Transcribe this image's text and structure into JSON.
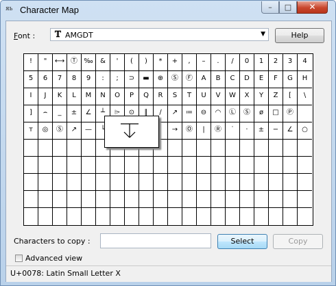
{
  "window": {
    "title": "Character Map"
  },
  "font": {
    "label_prefix": "F",
    "label_rest": "ont :",
    "value": "AMGDT",
    "font_type_icon": "truetype-icon"
  },
  "buttons": {
    "help": "Help",
    "select": "Select",
    "copy": "Copy"
  },
  "copy_field": {
    "label": "Characters to copy :",
    "value": ""
  },
  "advanced": {
    "label": "Advanced view",
    "checked": false
  },
  "status": "U+0078: Latin Small Letter X",
  "grid": {
    "rows": [
      [
        "!",
        "\"",
        "⟷",
        "Ⓣ",
        "‰",
        "&",
        "'",
        "(",
        ")",
        "*",
        "+",
        ",",
        "–",
        ".",
        "/",
        "0",
        "1",
        "2",
        "3",
        "4"
      ],
      [
        "5",
        "6",
        "7",
        "8",
        "9",
        ":",
        ";",
        "⊃",
        "▬",
        "⊕",
        "Ⓢ",
        "Ⓕ",
        "A",
        "B",
        "C",
        "D",
        "E",
        "F",
        "G",
        "H"
      ],
      [
        "I",
        "J",
        "K",
        "L",
        "M",
        "N",
        "O",
        "P",
        "Q",
        "R",
        "S",
        "T",
        "U",
        "V",
        "W",
        "X",
        "Y",
        "Z",
        "[",
        "\\"
      ],
      [
        "]",
        "⌢",
        "_",
        "±",
        "∠",
        "┴",
        "⌲",
        "⊙",
        "∥",
        "∕",
        "↗",
        "≔",
        "⊖",
        "◠",
        "Ⓛ",
        "Ⓢ",
        "ø",
        "□",
        "Ⓟ",
        ""
      ],
      [
        "т",
        "◎",
        "Ⓢ",
        "↗",
        "—",
        "└",
        "",
        "",
        "",
        "",
        "→",
        "Ⓞ",
        "|",
        "Ⓡ",
        "˙",
        "·",
        "±",
        "−",
        "∠",
        "○"
      ],
      [
        "",
        "",
        "",
        "",
        "",
        "",
        "",
        "",
        "",
        "",
        "",
        "",
        "",
        "",
        "",
        "",
        "",
        "",
        "",
        ""
      ],
      [
        "",
        "",
        "",
        "",
        "",
        "",
        "",
        "",
        "",
        "",
        "",
        "",
        "",
        "",
        "",
        "",
        "",
        "",
        "",
        ""
      ],
      [
        "",
        "",
        "",
        "",
        "",
        "",
        "",
        "",
        "",
        "",
        "",
        "",
        "",
        "",
        "",
        "",
        "",
        "",
        "",
        ""
      ],
      [
        "",
        "",
        "",
        "",
        "",
        "",
        "",
        "",
        "",
        "",
        "",
        "",
        "",
        "",
        "",
        "",
        "",
        "",
        "",
        ""
      ],
      [
        "",
        "",
        "",
        "",
        "",
        "",
        "",
        "",
        "",
        "",
        "",
        "",
        "",
        "",
        "",
        "",
        "",
        "",
        "",
        ""
      ]
    ],
    "zoom_glyph": "countersink-depth-symbol"
  }
}
